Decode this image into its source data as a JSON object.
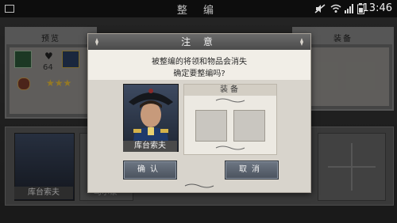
{
  "statusbar": {
    "screen_title": "整 编",
    "time": "13:46"
  },
  "background": {
    "preview_label": "预览",
    "equipment_label": "装备",
    "count_value": "64",
    "stars": "★★★",
    "left_general_name": "库台索夫",
    "second_general_name": "马尔蒙"
  },
  "dialog": {
    "title": "注 意",
    "message_line1": "被整编的将领和物品会消失",
    "message_line2": "确定要整编吗?",
    "general_name": "库台索夫",
    "equipment_title": "装备",
    "confirm_label": "确认",
    "cancel_label": "取消"
  }
}
